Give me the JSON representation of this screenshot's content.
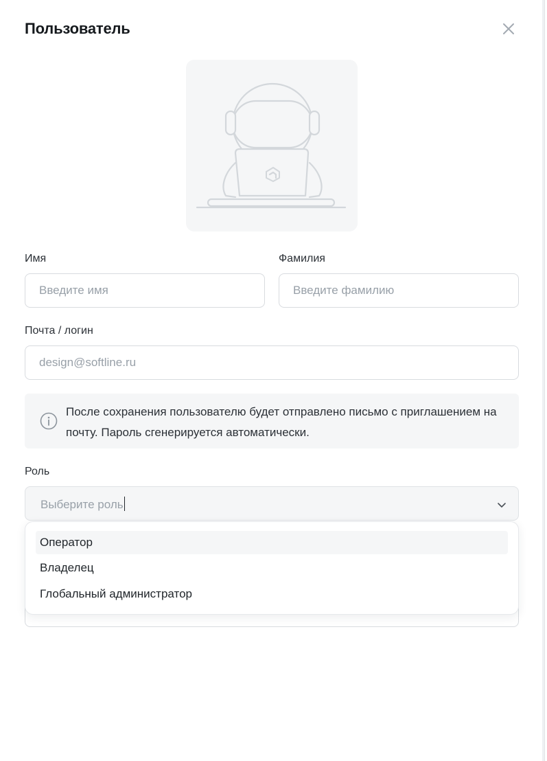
{
  "dialog": {
    "title": "Пользователь",
    "close_icon": "close-icon"
  },
  "avatar": {
    "icon": "astronaut-laptop-illustration"
  },
  "form": {
    "first_name": {
      "label": "Имя",
      "placeholder": "Введите имя",
      "value": ""
    },
    "last_name": {
      "label": "Фамилия",
      "placeholder": "Введите фамилию",
      "value": ""
    },
    "email": {
      "label": "Почта / логин",
      "placeholder": "design@softline.ru",
      "value": ""
    },
    "info": {
      "icon": "info-icon",
      "text": "После сохранения пользователю будет отправлено письмо с приглашением на почту. Пароль сгенерируется автоматически."
    },
    "role": {
      "label": "Роль",
      "placeholder": "Выберите роль",
      "chevron_icon": "chevron-down-icon",
      "options": [
        {
          "label": "Оператор",
          "highlighted": true
        },
        {
          "label": "Владелец",
          "highlighted": false
        },
        {
          "label": "Глобальный администратор",
          "highlighted": false
        }
      ]
    }
  },
  "colors": {
    "panel_background": "#ffffff",
    "muted_surface": "#f5f6f7",
    "border": "#d8dbdf",
    "placeholder_text": "#98a0a8",
    "body_text": "#1f2429"
  }
}
